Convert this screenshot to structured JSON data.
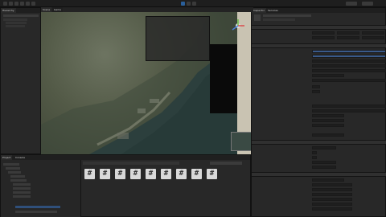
{
  "toolbar": {
    "left_buttons": 6,
    "play_label": "Play"
  },
  "hierarchy": {
    "tab_label": "Hierarchy",
    "items": [
      "",
      "",
      ""
    ]
  },
  "scene": {
    "tabs": [
      "Scene",
      "Game"
    ],
    "colors": {
      "land": "#5a6350",
      "water": "#2b3e3c",
      "minimap": "#0a0a0a",
      "shore": "#c9c3b2"
    }
  },
  "inspector": {
    "tabs": [
      "Inspector",
      "Services"
    ],
    "component_headers": [
      "Transform",
      "Camera",
      "Script",
      "Script"
    ],
    "rows": 34
  },
  "project": {
    "tabs": [
      "Project",
      "Console"
    ],
    "folders": [
      "",
      "",
      "",
      "",
      "",
      "",
      "",
      "",
      "",
      "",
      ""
    ],
    "asset_icon_glyph": "#",
    "asset_count": 9
  }
}
